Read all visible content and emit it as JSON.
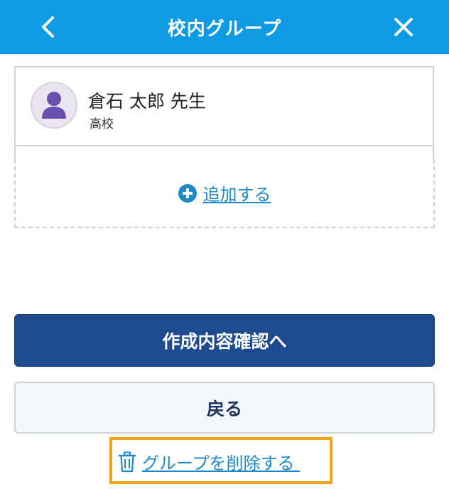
{
  "header": {
    "title": "校内グループ",
    "back_icon": "chevron-left-icon",
    "close_icon": "close-icon",
    "color": "#0f9be3"
  },
  "member": {
    "name": "倉石 太郎 先生",
    "school": "高校",
    "avatar_icon": "person-avatar-icon",
    "avatar_color": "#6a4fae"
  },
  "add": {
    "label": "追加する",
    "icon": "plus-circle-icon"
  },
  "actions": {
    "confirm_label": "作成内容確認へ",
    "back_label": "戻る",
    "delete_label": "グループを削除する ",
    "delete_icon": "trash-icon",
    "confirm_color": "#1e4b8f",
    "link_color": "#1d89c9",
    "highlight_color": "#f5a31a"
  }
}
